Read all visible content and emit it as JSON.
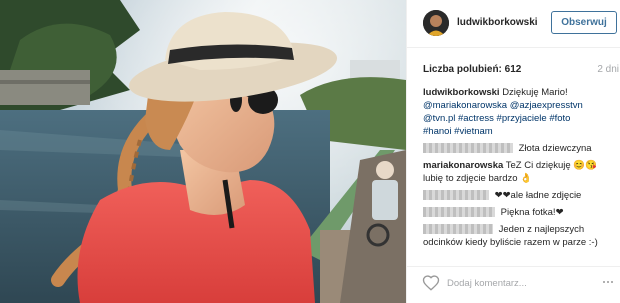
{
  "post": {
    "username": "ludwikborkowski",
    "follow_label": "Obserwuj",
    "likes_label": "Liczba polubień: 612",
    "time_ago": "2 dni",
    "caption_user": "ludwikborkowski",
    "caption_text": "Dziękuję Mario!",
    "tags_line1": "@mariakonarowska @azjaexpresstvn",
    "tags_line2": "@tvn.pl #actress #przyjaciele #foto",
    "tags_line3": "#hanoi #vietnam"
  },
  "comments": [
    {
      "user": "",
      "text": "Złota dziewczyna"
    },
    {
      "user": "mariakonarowska",
      "text": "TeZ Ci dziękuję 😊😘 lubię to zdjęcie bardzo 👌"
    },
    {
      "user": "",
      "text": "❤❤ale ładne zdjęcie"
    },
    {
      "user": "",
      "text": "Piękna fotka!❤"
    },
    {
      "user": "",
      "text": "Jeden z najlepszych odcinków kiedy byliście razem w parze :-)"
    }
  ],
  "footer": {
    "comment_placeholder": "Dodaj komentarz..."
  },
  "icons": {
    "like": "heart-icon",
    "more": "more-options-icon"
  },
  "colors": {
    "follow_accent": "#3f729b",
    "tag_link": "#003569",
    "muted": "#a5a7aa"
  }
}
